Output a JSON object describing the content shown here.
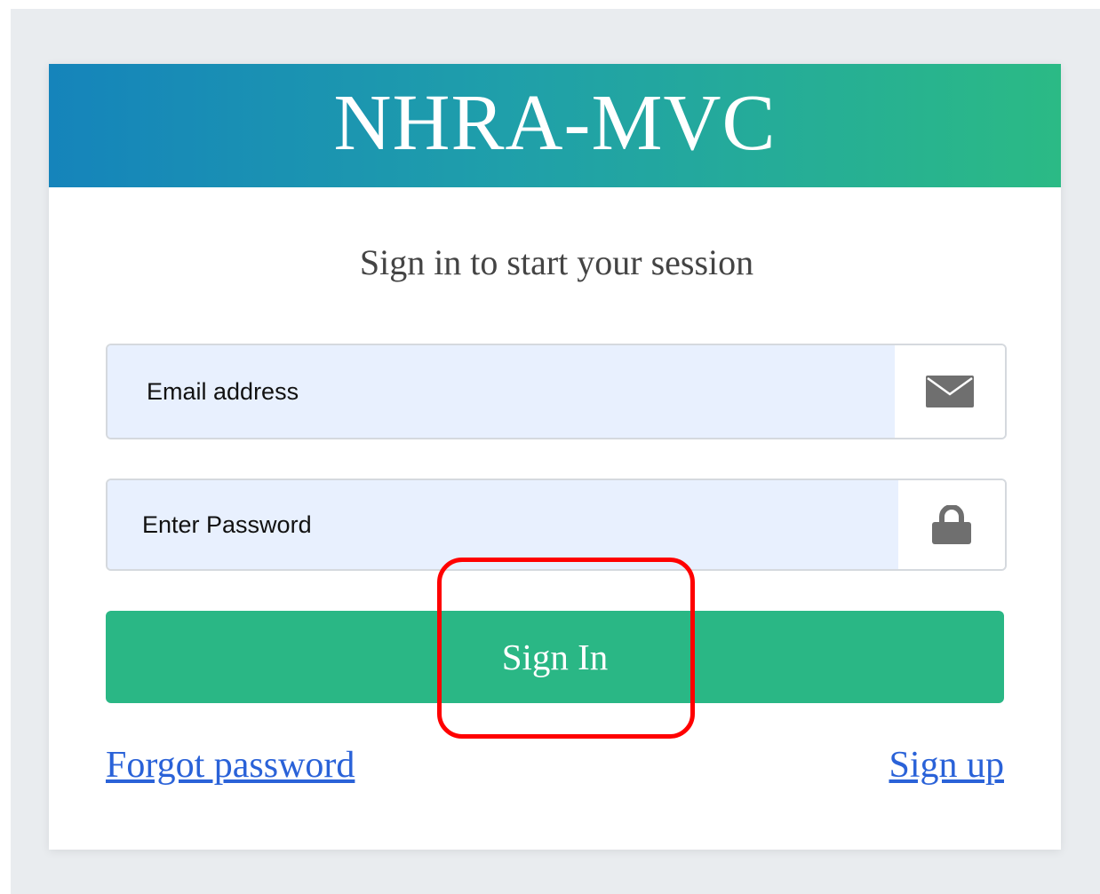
{
  "app": {
    "title": "NHRA-MVC"
  },
  "login": {
    "subtitle": "Sign in to start your session",
    "email": {
      "value": "",
      "placeholder": "Email address",
      "icon": "envelope-icon"
    },
    "password": {
      "value": "",
      "placeholder": "Enter Password",
      "icon": "lock-icon"
    },
    "signin_label": "Sign In",
    "forgot_label": "Forgot password",
    "signup_label": "Sign up"
  },
  "colors": {
    "header_gradient_start": "#1584bb",
    "header_gradient_end": "#2bba85",
    "button": "#2ab785",
    "input_fill": "#e8f0fe",
    "link": "#2a62d8",
    "highlight": "#ff0000"
  }
}
